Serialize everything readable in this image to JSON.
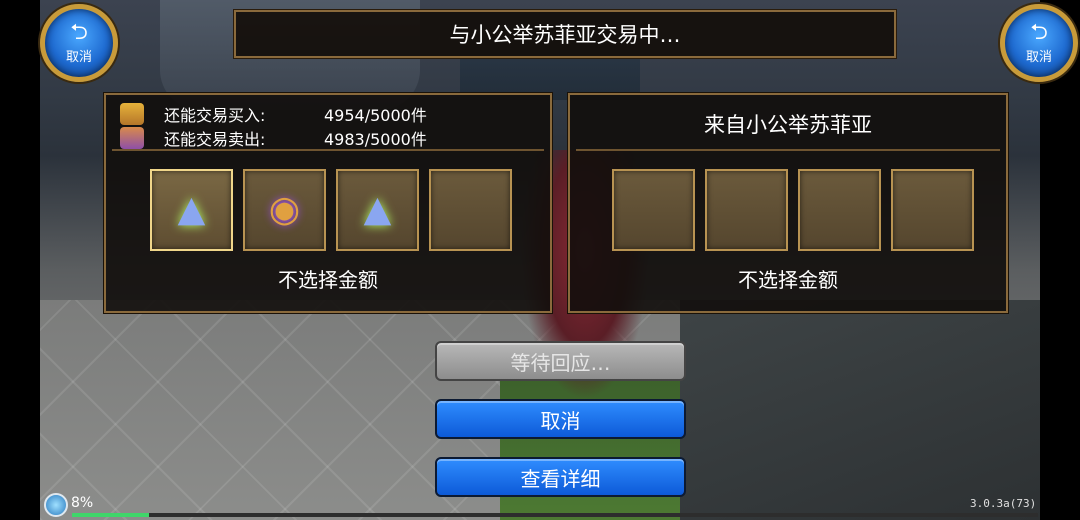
{
  "header": {
    "title": "与小公举苏菲亚交易中…",
    "cancel_left": {
      "glyph": "⮌",
      "label": "取消"
    },
    "cancel_right": {
      "glyph": "⮌",
      "label": "取消"
    }
  },
  "my_panel": {
    "buy_label": "还能交易买入:",
    "buy_value": "4954/5000件",
    "sell_label": "还能交易卖出:",
    "sell_value": "4983/5000件",
    "slots": [
      {
        "item": "wizard-hat",
        "glyph": "▲",
        "selected": true
      },
      {
        "item": "ring",
        "glyph": "◉",
        "selected": false
      },
      {
        "item": "wizard-hat",
        "glyph": "▲",
        "selected": false
      },
      {
        "item": "empty",
        "glyph": "",
        "selected": false
      }
    ],
    "money": "不选择金额"
  },
  "partner_panel": {
    "title": "来自小公举苏菲亚",
    "slots": [
      {
        "item": "empty",
        "glyph": ""
      },
      {
        "item": "empty",
        "glyph": ""
      },
      {
        "item": "empty",
        "glyph": ""
      },
      {
        "item": "empty",
        "glyph": ""
      }
    ],
    "money": "不选择金额"
  },
  "actions": {
    "wait": "等待回应…",
    "cancel": "取消",
    "detail": "查看详细"
  },
  "hud": {
    "percent": "8%",
    "progress": 0.08,
    "version": "3.0.3a(73)"
  },
  "colors": {
    "frame_gold": "#8a6a3c",
    "button_blue": "#1e6ad0",
    "button_gray": "#a0a0a0"
  }
}
